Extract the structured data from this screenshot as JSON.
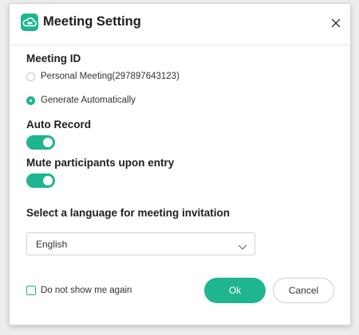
{
  "dialog": {
    "title": "Meeting Setting",
    "logo_icon": "cloud-camera-icon",
    "close_icon": "close-icon",
    "accent_color": "#1fb58f"
  },
  "meeting_id": {
    "label": "Meeting ID",
    "options": [
      {
        "label": "Personal Meeting(297897643123)",
        "selected": false
      },
      {
        "label": "Generate Automatically",
        "selected": true
      }
    ]
  },
  "auto_record": {
    "label": "Auto Record",
    "enabled": true
  },
  "mute_on_entry": {
    "label": "Mute participants upon entry",
    "enabled": true
  },
  "language": {
    "label": "Select a language for meeting invitation",
    "selected": "English",
    "dropdown_icon": "chevron-down-icon"
  },
  "footer": {
    "dont_show_label": "Do not show me again",
    "dont_show_checked": false,
    "ok_label": "Ok",
    "cancel_label": "Cancel"
  }
}
